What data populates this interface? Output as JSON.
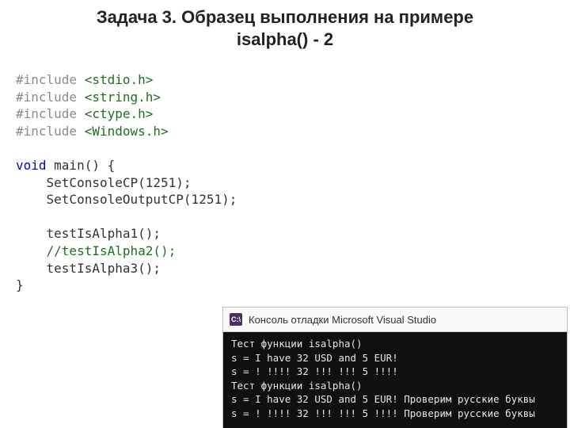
{
  "title_line1": "Задача 3. Образец выполнения на примере",
  "title_line2": "isalpha() - 2",
  "code": {
    "inc1_pp": "#include",
    "inc1_hdr": "<stdio.h>",
    "inc2_pp": "#include",
    "inc2_hdr": "<string.h>",
    "inc3_pp": "#include",
    "inc3_hdr": "<ctype.h>",
    "inc4_pp": "#include",
    "inc4_hdr": "<Windows.h>",
    "kw_void": "void",
    "main_sig": " main() {",
    "l_setcp": "    SetConsoleCP(1251);",
    "l_setoutcp": "    SetConsoleOutputCP(1251);",
    "l_blank": "",
    "l_t1": "    testIsAlpha1();",
    "l_t2cmt": "    //testIsAlpha2();",
    "l_t3": "    testIsAlpha3();",
    "l_close": "}"
  },
  "console": {
    "icon_text": "C:\\",
    "title": "Консоль отладки Microsoft Visual Studio",
    "lines": [
      "Тест функции isalpha()",
      "s = I have 32 USD and 5 EUR!",
      "s = ! !!!! 32 !!! !!! 5 !!!!",
      "Тест функции isalpha()",
      "s = I have 32 USD and 5 EUR! Проверим русские буквы",
      "s = ! !!!! 32 !!! !!! 5 !!!! Проверим русские буквы"
    ]
  }
}
